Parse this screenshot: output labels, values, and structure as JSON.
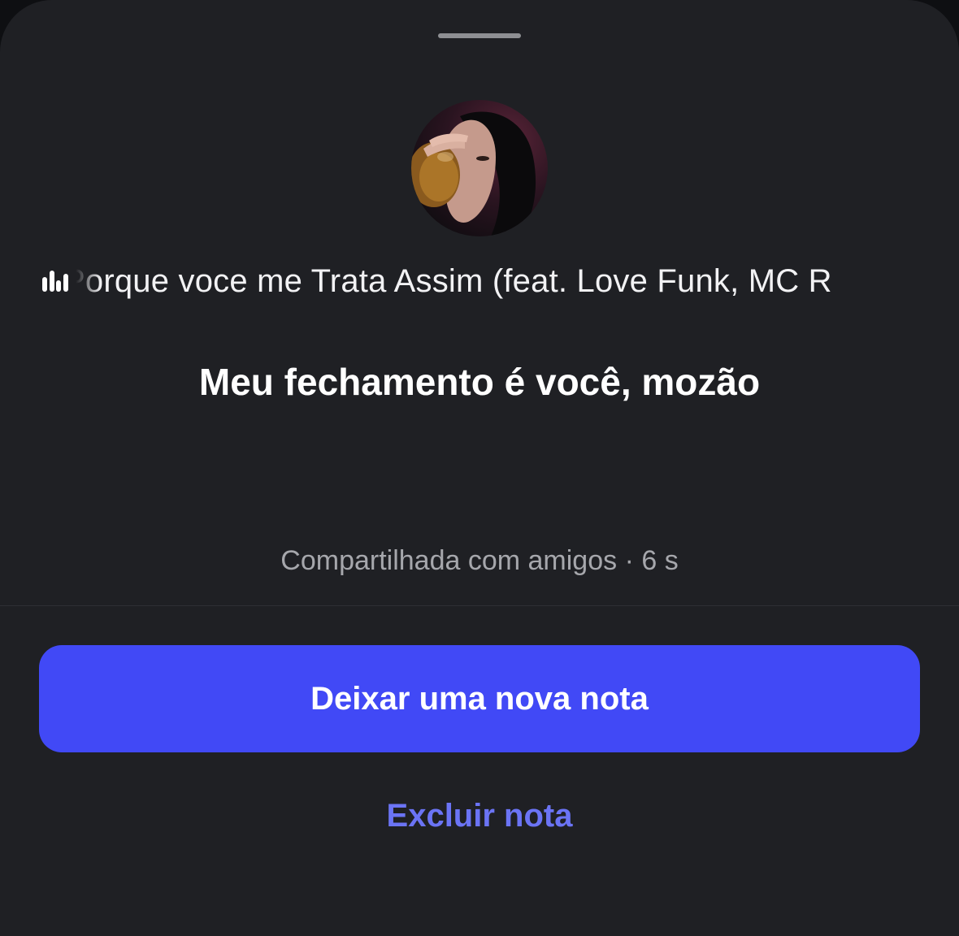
{
  "note": {
    "song_title": "Porque voce me Trata Assim (feat. Love Funk, MC R",
    "text": "Meu fechamento é você, mozão",
    "meta": "Compartilhada com amigos · 6 s",
    "music_icon": "music-bars-icon"
  },
  "actions": {
    "primary_label": "Deixar uma nova nota",
    "delete_label": "Excluir nota"
  },
  "colors": {
    "sheet_background": "#1f2024",
    "primary_button": "#4149f6",
    "delete_text": "#6b74f5",
    "meta_text": "#a6a7ac"
  }
}
